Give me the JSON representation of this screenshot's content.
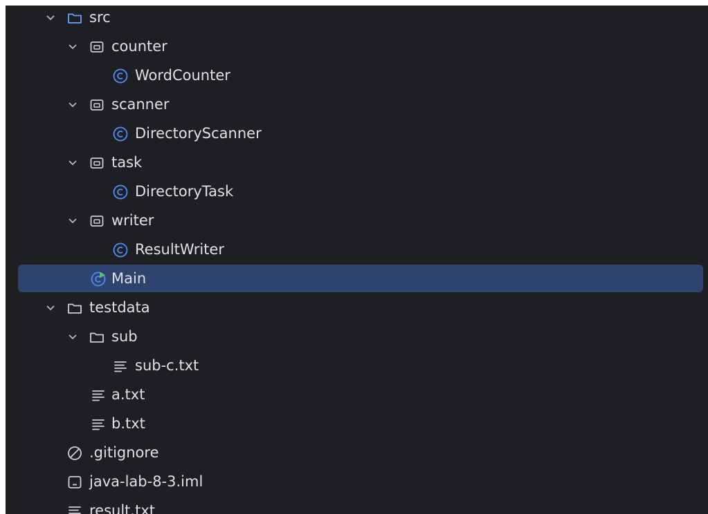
{
  "tree": {
    "src": {
      "label": "src",
      "icon": "source-folder-icon"
    },
    "counter": {
      "label": "counter",
      "icon": "package-icon"
    },
    "word_counter": {
      "label": "WordCounter",
      "icon": "java-class-icon"
    },
    "scanner": {
      "label": "scanner",
      "icon": "package-icon"
    },
    "directory_scanner": {
      "label": "DirectoryScanner",
      "icon": "java-class-icon"
    },
    "task": {
      "label": "task",
      "icon": "package-icon"
    },
    "directory_task": {
      "label": "DirectoryTask",
      "icon": "java-class-icon"
    },
    "writer": {
      "label": "writer",
      "icon": "package-icon"
    },
    "result_writer": {
      "label": "ResultWriter",
      "icon": "java-class-icon"
    },
    "main": {
      "label": "Main",
      "icon": "runnable-class-icon",
      "selected": true
    },
    "testdata": {
      "label": "testdata",
      "icon": "folder-icon"
    },
    "sub": {
      "label": "sub",
      "icon": "folder-icon"
    },
    "sub_c": {
      "label": "sub-c.txt",
      "icon": "text-file-icon"
    },
    "a_txt": {
      "label": "a.txt",
      "icon": "text-file-icon"
    },
    "b_txt": {
      "label": "b.txt",
      "icon": "text-file-icon"
    },
    "gitignore": {
      "label": ".gitignore",
      "icon": "ignored-file-icon"
    },
    "iml": {
      "label": "java-lab-8-3.iml",
      "icon": "module-file-icon"
    },
    "result_txt": {
      "label": "result.txt",
      "icon": "text-file-icon"
    }
  },
  "colors": {
    "background": "#1e1f22",
    "selection": "#2e436e",
    "text": "#dfe1e5",
    "source_folder": "#6fa0ff",
    "class_icon": "#4a86f0",
    "run_badge": "#57c26a"
  }
}
